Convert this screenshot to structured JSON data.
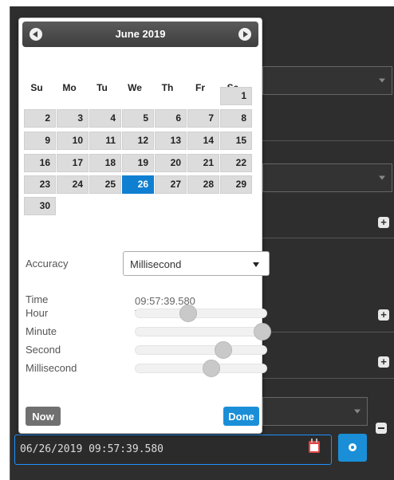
{
  "calendar": {
    "month_title": "June 2019",
    "weekdays": [
      "Su",
      "Mo",
      "Tu",
      "We",
      "Th",
      "Fr",
      "Sa"
    ],
    "days": [
      "1",
      "2",
      "3",
      "4",
      "5",
      "6",
      "7",
      "8",
      "9",
      "10",
      "11",
      "12",
      "13",
      "14",
      "15",
      "16",
      "17",
      "18",
      "19",
      "20",
      "21",
      "22",
      "23",
      "24",
      "25",
      "26",
      "27",
      "28",
      "29",
      "30"
    ],
    "selected_day": "26"
  },
  "time_panel": {
    "accuracy_label": "Accuracy",
    "accuracy_value": "Millisecond",
    "time_label": "Time",
    "time_value": "09:57:39.580",
    "sliders": [
      {
        "label": "Hour",
        "fraction": 0.4
      },
      {
        "label": "Minute",
        "fraction": 0.97
      },
      {
        "label": "Second",
        "fraction": 0.67
      },
      {
        "label": "Millisecond",
        "fraction": 0.58
      }
    ]
  },
  "buttons": {
    "now_label": "Now",
    "done_label": "Done"
  },
  "date_input": {
    "value": "06/26/2019 09:57:39.580"
  },
  "icons": {
    "prev": "chevron-left-icon",
    "next": "chevron-right-icon",
    "calendar": "calendar-icon",
    "settings": "gear-icon",
    "add": "plus-icon",
    "remove": "minus-icon"
  },
  "colors": {
    "accent": "#1a8fd8",
    "selected_day": "#0f7fd1",
    "now_button": "#707070",
    "calendar_icon": "#e04848"
  }
}
